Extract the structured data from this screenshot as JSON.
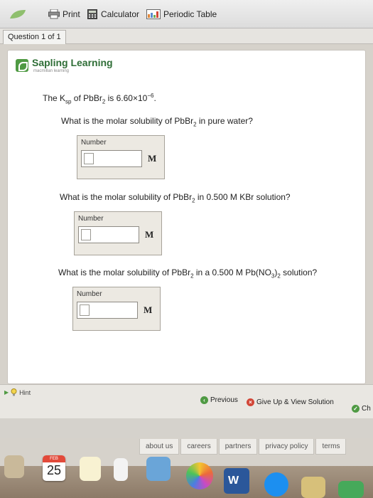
{
  "toolbar": {
    "print_label": "Print",
    "calculator_label": "Calculator",
    "periodic_table_label": "Periodic Table"
  },
  "question_tab": {
    "label": "Question 1 of 1"
  },
  "brand": {
    "name": "Sapling Learning",
    "subtitle": "macmillan learning"
  },
  "question": {
    "ksp_prefix": "The K",
    "ksp_sub": "sp",
    "ksp_mid": " of PbBr",
    "ksp_mid_sub": "2",
    "ksp_value": " is 6.60×10",
    "ksp_exp": "−6",
    "ksp_end": ".",
    "parts": [
      {
        "text_a": "What is the molar solubility of PbBr",
        "sub": "2",
        "text_b": " in pure water?",
        "field_label": "Number",
        "unit": "M",
        "value": ""
      },
      {
        "text_a": "What is the molar solubility of PbBr",
        "sub": "2",
        "text_b": " in 0.500 M KBr solution?",
        "field_label": "Number",
        "unit": "M",
        "value": ""
      },
      {
        "text_a": "What is the molar solubility of PbBr",
        "sub": "2",
        "text_b": " in a 0.500 M Pb(NO",
        "sub2": "3",
        "text_c": ")",
        "sub3": "2",
        "text_d": " solution?",
        "field_label": "Number",
        "unit": "M",
        "value": ""
      }
    ]
  },
  "nav": {
    "hint_label": "Hint",
    "previous_label": "Previous",
    "give_up_label": "Give Up & View Solution",
    "check_label": "Ch"
  },
  "footer": {
    "links": [
      "about us",
      "careers",
      "partners",
      "privacy policy",
      "terms"
    ]
  },
  "dock": {
    "calendar_month": "FEB",
    "calendar_day": "25",
    "word_letter": "W"
  },
  "colors": {
    "brand_green": "#2f6e37",
    "logo_green": "#4f9a43",
    "give_up_red": "#d24637"
  }
}
